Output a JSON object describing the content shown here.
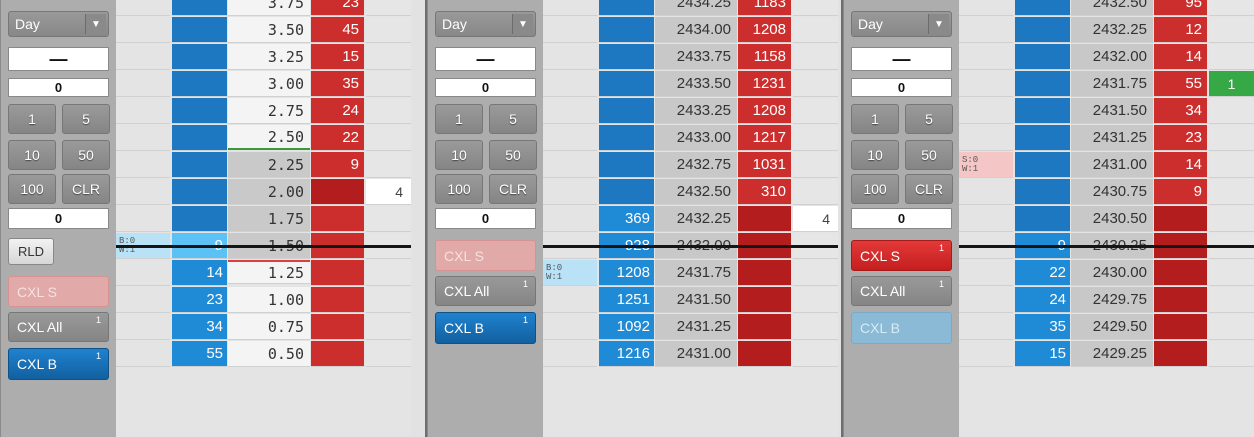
{
  "panels": [
    {
      "controls": {
        "tif": "Day",
        "dash": "—",
        "qty_top": "0",
        "q1": "1",
        "q5": "5",
        "q10": "10",
        "q50": "50",
        "q100": "100",
        "clr": "CLR",
        "qty_bottom": "0",
        "rld": "RLD",
        "cxl_s": "CXL S",
        "cxl_s_count": "",
        "cxl_all": "CXL All",
        "cxl_all_count": "1",
        "cxl_b": "CXL B",
        "cxl_b_count": "1",
        "has_rld": true,
        "cxl_s_active": false,
        "cxl_b_active": true
      },
      "rows": [
        {
          "price": "3.75",
          "ask": "23"
        },
        {
          "price": "3.50",
          "ask": "45"
        },
        {
          "price": "3.25",
          "ask": "15"
        },
        {
          "price": "3.00",
          "ask": "35"
        },
        {
          "price": "2.75",
          "ask": "24"
        },
        {
          "price": "2.50",
          "ask": "22",
          "greenline": true
        },
        {
          "price": "2.25",
          "ask": "9",
          "below": true
        },
        {
          "price": "2.00",
          "below": true,
          "ask_dark": true,
          "order": "4",
          "order_white": true
        },
        {
          "price": "1.75",
          "below": true
        },
        {
          "price": "1.50",
          "below": true,
          "bid": "9",
          "bid_hl": true,
          "redline_under": true,
          "note": [
            "B:0",
            "W:1"
          ],
          "note_style": "blue"
        },
        {
          "price": "1.25",
          "bid": "14",
          "redline": true
        },
        {
          "price": "1.00",
          "bid": "23"
        },
        {
          "price": "0.75",
          "bid": "34"
        },
        {
          "price": "0.50",
          "bid": "55"
        }
      ]
    },
    {
      "controls": {
        "tif": "Day",
        "dash": "—",
        "qty_top": "0",
        "q1": "1",
        "q5": "5",
        "q10": "10",
        "q50": "50",
        "q100": "100",
        "clr": "CLR",
        "qty_bottom": "0",
        "rld": "",
        "cxl_s": "CXL S",
        "cxl_s_count": "",
        "cxl_all": "CXL All",
        "cxl_all_count": "1",
        "cxl_b": "CXL B",
        "cxl_b_count": "1",
        "has_rld": false,
        "cxl_s_active": false,
        "cxl_b_active": true
      },
      "rows": [
        {
          "price": "2434.25",
          "ask": "1183",
          "price_gray": true
        },
        {
          "price": "2434.00",
          "ask": "1208",
          "price_gray": true
        },
        {
          "price": "2433.75",
          "ask": "1158",
          "price_gray": true
        },
        {
          "price": "2433.50",
          "ask": "1231",
          "price_gray": true
        },
        {
          "price": "2433.25",
          "ask": "1208",
          "price_gray": true
        },
        {
          "price": "2433.00",
          "ask": "1217",
          "price_gray": true
        },
        {
          "price": "2432.75",
          "ask": "1031",
          "price_gray": true
        },
        {
          "price": "2432.50",
          "ask": "310",
          "price_gray": true
        },
        {
          "price": "2432.25",
          "bid": "369",
          "ask_dark": true,
          "order": "4",
          "order_white": true,
          "price_gray": true
        },
        {
          "price": "2432.00",
          "bid": "928",
          "ask_dark": true,
          "price_gray": true
        },
        {
          "price": "2431.75",
          "bid": "1208",
          "ask_dark": true,
          "note": [
            "B:0",
            "W:1"
          ],
          "note_style": "blue",
          "price_gray": true
        },
        {
          "price": "2431.50",
          "bid": "1251",
          "ask_dark": true,
          "price_gray": true
        },
        {
          "price": "2431.25",
          "bid": "1092",
          "ask_dark": true,
          "price_gray": true
        },
        {
          "price": "2431.00",
          "bid": "1216",
          "ask_dark": true,
          "price_gray": true
        }
      ]
    },
    {
      "controls": {
        "tif": "Day",
        "dash": "—",
        "qty_top": "0",
        "q1": "1",
        "q5": "5",
        "q10": "10",
        "q50": "50",
        "q100": "100",
        "clr": "CLR",
        "qty_bottom": "0",
        "rld": "",
        "cxl_s": "CXL S",
        "cxl_s_count": "1",
        "cxl_all": "CXL All",
        "cxl_all_count": "1",
        "cxl_b": "CXL B",
        "cxl_b_count": "",
        "has_rld": false,
        "cxl_s_active": true,
        "cxl_b_active": false
      },
      "rows": [
        {
          "price": "2432.50",
          "ask": "95",
          "price_gray": true
        },
        {
          "price": "2432.25",
          "ask": "12",
          "price_gray": true
        },
        {
          "price": "2432.00",
          "ask": "14",
          "price_gray": true
        },
        {
          "price": "2431.75",
          "ask": "55",
          "order": "1",
          "order_green": true,
          "price_gray": true
        },
        {
          "price": "2431.50",
          "ask": "34",
          "price_gray": true
        },
        {
          "price": "2431.25",
          "ask": "23",
          "price_gray": true
        },
        {
          "price": "2431.00",
          "ask": "14",
          "note": [
            "S:0",
            "W:1"
          ],
          "note_style": "pink",
          "price_gray": true
        },
        {
          "price": "2430.75",
          "ask": "9",
          "price_gray": true
        },
        {
          "price": "2430.50",
          "ask_dark": true,
          "price_gray": true
        },
        {
          "price": "2430.25",
          "bid": "9",
          "ask_dark": true,
          "price_gray": true
        },
        {
          "price": "2430.00",
          "bid": "22",
          "ask_dark": true,
          "price_gray": true
        },
        {
          "price": "2429.75",
          "bid": "24",
          "ask_dark": true,
          "price_gray": true
        },
        {
          "price": "2429.50",
          "bid": "35",
          "ask_dark": true,
          "price_gray": true
        },
        {
          "price": "2429.25",
          "bid": "15",
          "ask_dark": true,
          "price_gray": true
        }
      ]
    }
  ],
  "colors": {
    "bid": "#1e78c1",
    "bid_filled": "#1f8bd6",
    "ask": "#cc2d2d",
    "ask_dark": "#b41d1d",
    "order_green": "#36a845"
  }
}
